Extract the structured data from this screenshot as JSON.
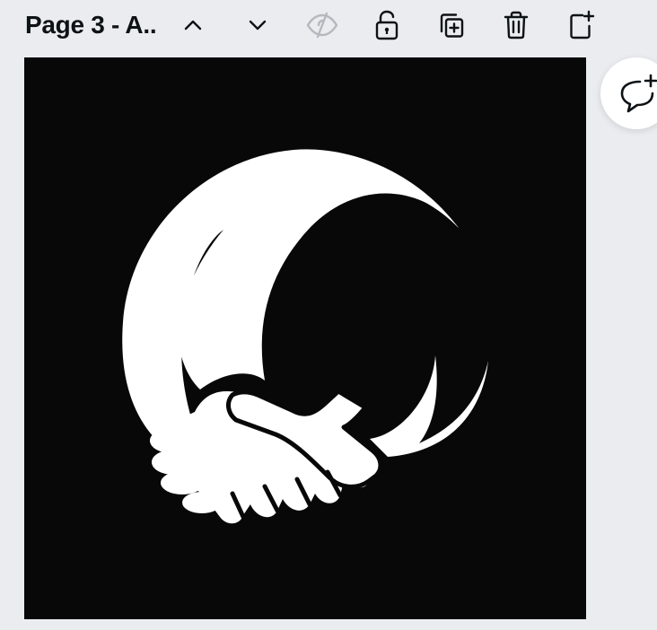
{
  "toolbar": {
    "page_title": "Page 3 - A..",
    "icons": {
      "move_up": "chevron-up-icon",
      "move_down": "chevron-down-icon",
      "hide": "eye-slash-icon",
      "lock": "unlock-icon",
      "duplicate": "duplicate-icon",
      "delete": "trash-icon",
      "add_page": "add-page-icon"
    }
  },
  "canvas": {
    "background": "#080808",
    "graphic": "handshake-circle-logo",
    "graphic_color": "#ffffff"
  },
  "comment": {
    "icon": "add-comment-icon"
  },
  "colors": {
    "workspace": "#ebecf0",
    "icon": "#0d1216",
    "icon_disabled": "#b6b8bf"
  }
}
